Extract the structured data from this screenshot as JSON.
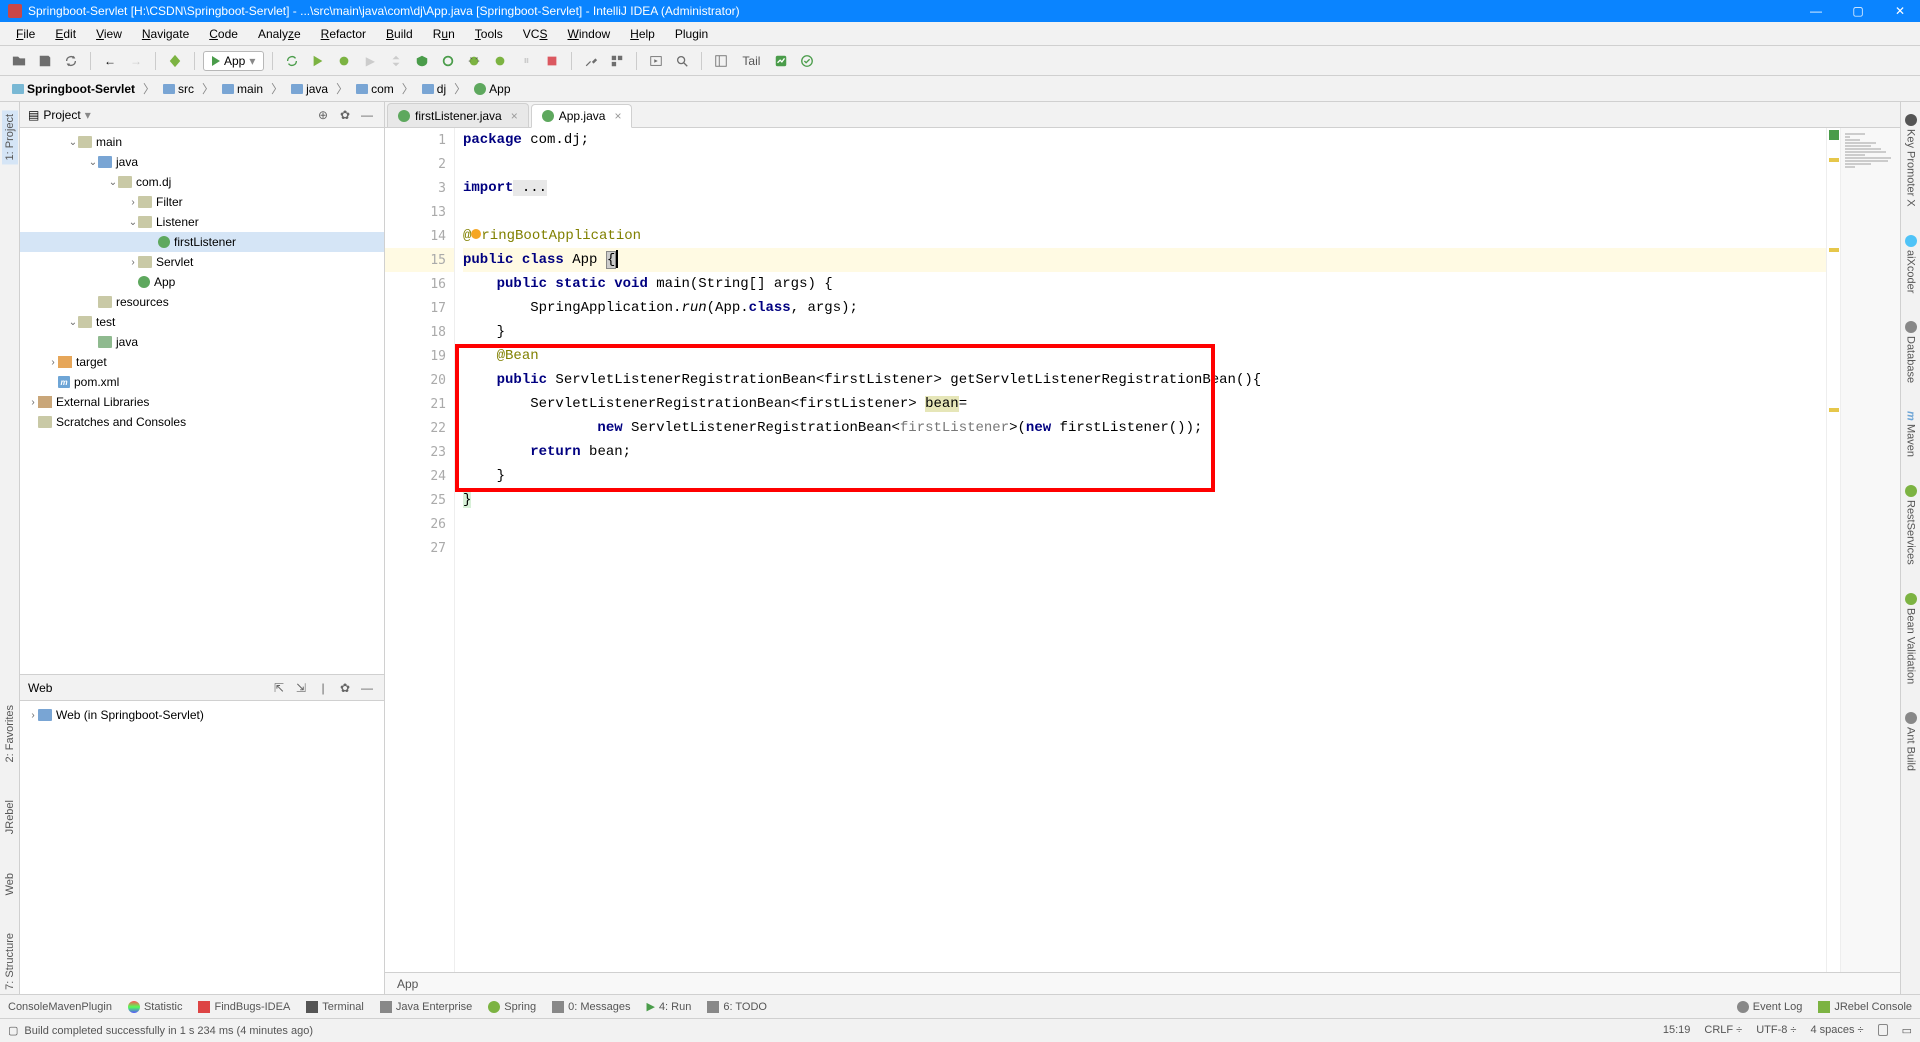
{
  "title_bar": {
    "text": "Springboot-Servlet [H:\\CSDN\\Springboot-Servlet] - ...\\src\\main\\java\\com\\dj\\App.java [Springboot-Servlet] - IntelliJ IDEA (Administrator)"
  },
  "menu": {
    "file": "File",
    "edit": "Edit",
    "view": "View",
    "navigate": "Navigate",
    "code": "Code",
    "analyze": "Analyze",
    "refactor": "Refactor",
    "build": "Build",
    "run": "Run",
    "tools": "Tools",
    "vcs": "VCS",
    "window": "Window",
    "help": "Help",
    "plugin": "Plugin"
  },
  "toolbar": {
    "run_config": "App",
    "tail": "Tail"
  },
  "breadcrumb": {
    "root": "Springboot-Servlet",
    "src": "src",
    "main": "main",
    "java": "java",
    "com": "com",
    "dj": "dj",
    "app": "App"
  },
  "project_panel": {
    "title": "Project",
    "tree": {
      "main": "main",
      "java": "java",
      "comdj": "com.dj",
      "filter": "Filter",
      "listener": "Listener",
      "firstListener": "firstListener",
      "servlet": "Servlet",
      "app": "App",
      "resources": "resources",
      "test": "test",
      "test_java": "java",
      "target": "target",
      "pom": "pom.xml",
      "ext_lib": "External Libraries",
      "scratches": "Scratches and Consoles"
    }
  },
  "web_panel": {
    "title": "Web",
    "item": "Web (in Springboot-Servlet)"
  },
  "left_tabs": {
    "project": "1: Project",
    "favorites": "2: Favorites",
    "jrebel": "JRebel",
    "web": "Web",
    "structure": "7: Structure"
  },
  "right_tabs": {
    "keypromoter": "Key Promoter X",
    "aixcoder": "aiXcoder",
    "database": "Database",
    "maven": "Maven",
    "restservices": "RestServices",
    "beanvalidation": "Bean Validation",
    "antbuild": "Ant Build"
  },
  "editor_tabs": {
    "tab1": "firstListener.java",
    "tab2": "App.java"
  },
  "code": {
    "l1_package": "package",
    "l1_pkg": " com.dj;",
    "l3_import": "import",
    "l3_rest": " ...",
    "l14_ann": "@SpringBootApplication",
    "l15_public": "public",
    "l15_class": "class",
    "l15_name": " App ",
    "l15_brace": "{",
    "l16_public": "public",
    "l16_static": " static",
    "l16_void": " void",
    "l16_main": " main(String[] args) {",
    "l17": "        SpringApplication.",
    "l17_run": "run",
    "l17_rest": "(App.",
    "l17_class": "class",
    "l17_end": ", args);",
    "l18": "    }",
    "l19_bean": "@Bean",
    "l20_public": "public",
    "l20_rest": " ServletListenerRegistrationBean<firstListener> getServletListenerRegistrationBean(){",
    "l21_a": "        ServletListenerRegistrationBean<firstListener> ",
    "l21_bean": "bean",
    "l21_eq": "=",
    "l22_a": "                ",
    "l22_new": "new",
    "l22_b": " ServletListenerRegistrationBean<",
    "l22_hint": "firstListener",
    "l22_c": ">(",
    "l22_new2": "new",
    "l22_d": " firstListener());",
    "l23_return": "return",
    "l23_rest": " bean;",
    "l24": "    }",
    "l25": "}",
    "line_numbers": [
      "1",
      "2",
      "3",
      "13",
      "14",
      "15",
      "16",
      "17",
      "18",
      "19",
      "20",
      "21",
      "22",
      "23",
      "24",
      "25",
      "26",
      "27"
    ]
  },
  "editor_crumb": "App",
  "bottom_bar": {
    "consolemaven": "ConsoleMavenPlugin",
    "statistic": "Statistic",
    "findbugs": "FindBugs-IDEA",
    "terminal": "Terminal",
    "javaee": "Java Enterprise",
    "spring": "Spring",
    "messages": "0: Messages",
    "run": "4: Run",
    "todo": "6: TODO",
    "eventlog": "Event Log",
    "jrebel": "JRebel Console"
  },
  "status_bar": {
    "msg": "Build completed successfully in 1 s 234 ms (4 minutes ago)",
    "pos": "15:19",
    "sep": "CRLF",
    "enc": "UTF-8",
    "indent": "4 spaces"
  }
}
